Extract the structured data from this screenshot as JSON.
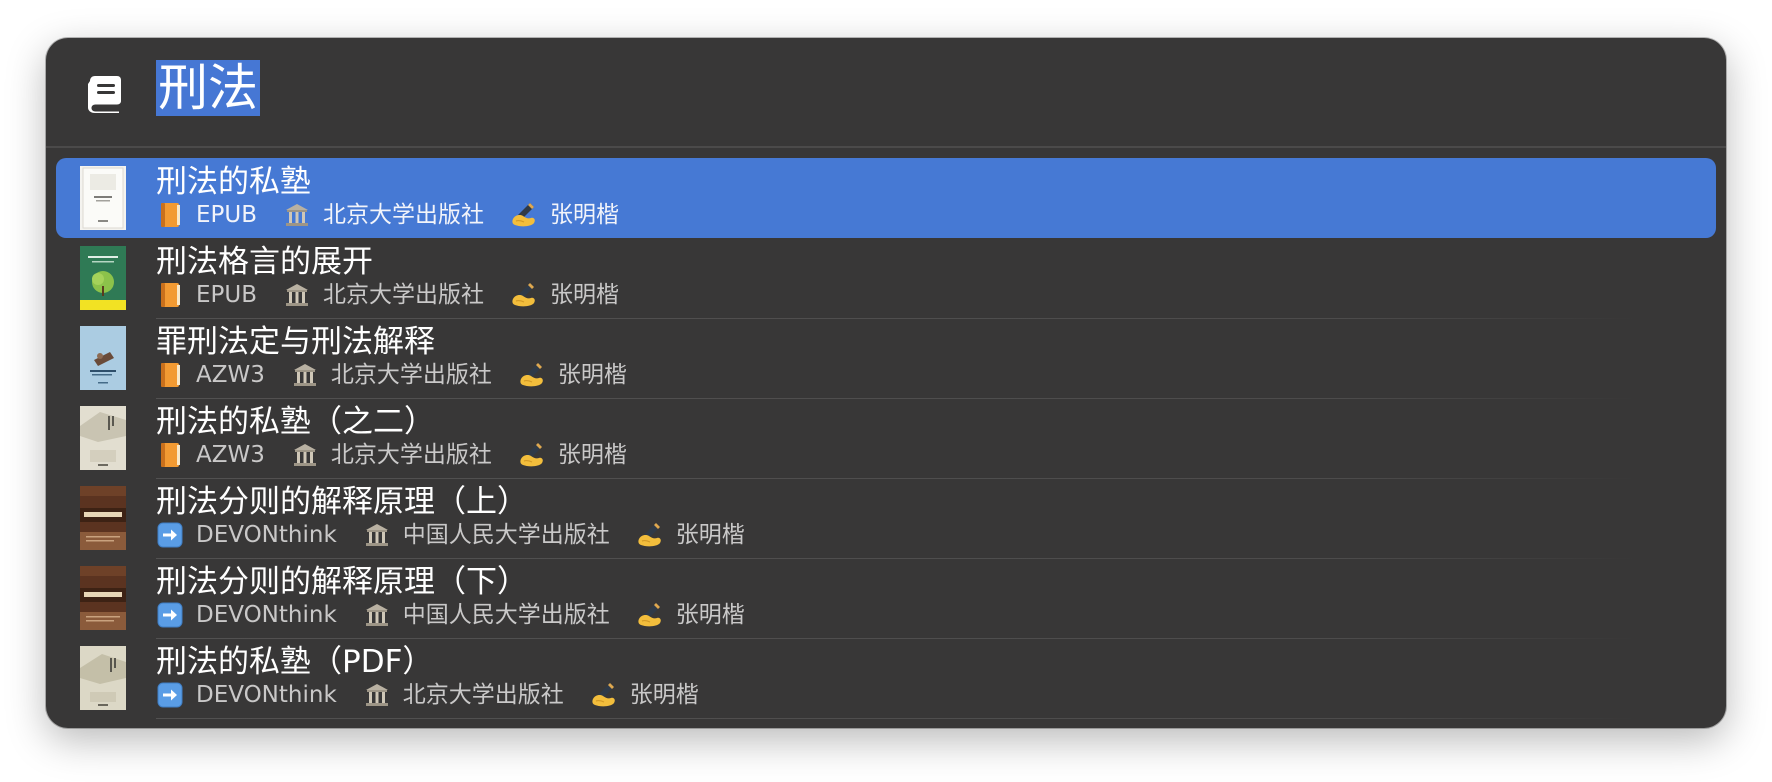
{
  "search": {
    "query": "刑法",
    "icon": "book-icon"
  },
  "results": [
    {
      "title": "刑法的私塾",
      "format": "EPUB",
      "format_icon": "orange-book-icon",
      "publisher": "北京大学出版社",
      "author": "张明楷",
      "selected": true
    },
    {
      "title": "刑法格言的展开",
      "format": "EPUB",
      "format_icon": "orange-book-icon",
      "publisher": "北京大学出版社",
      "author": "张明楷",
      "selected": false
    },
    {
      "title": "罪刑法定与刑法解释",
      "format": "AZW3",
      "format_icon": "orange-book-icon",
      "publisher": "北京大学出版社",
      "author": "张明楷",
      "selected": false
    },
    {
      "title": "刑法的私塾（之二）",
      "format": "AZW3",
      "format_icon": "orange-book-icon",
      "publisher": "北京大学出版社",
      "author": "张明楷",
      "selected": false
    },
    {
      "title": "刑法分则的解释原理（上）",
      "format": "DEVONthink",
      "format_icon": "right-arrow-icon",
      "publisher": "中国人民大学出版社",
      "author": "张明楷",
      "selected": false
    },
    {
      "title": "刑法分则的解释原理（下）",
      "format": "DEVONthink",
      "format_icon": "right-arrow-icon",
      "publisher": "中国人民大学出版社",
      "author": "张明楷",
      "selected": false
    },
    {
      "title": "刑法的私塾（PDF）",
      "format": "DEVONthink",
      "format_icon": "right-arrow-icon",
      "publisher": "北京大学出版社",
      "author": "张明楷",
      "selected": false
    }
  ],
  "colors": {
    "window_bg": "#383737",
    "selection": "#4679d4",
    "query_highlight": "#4677d4"
  }
}
